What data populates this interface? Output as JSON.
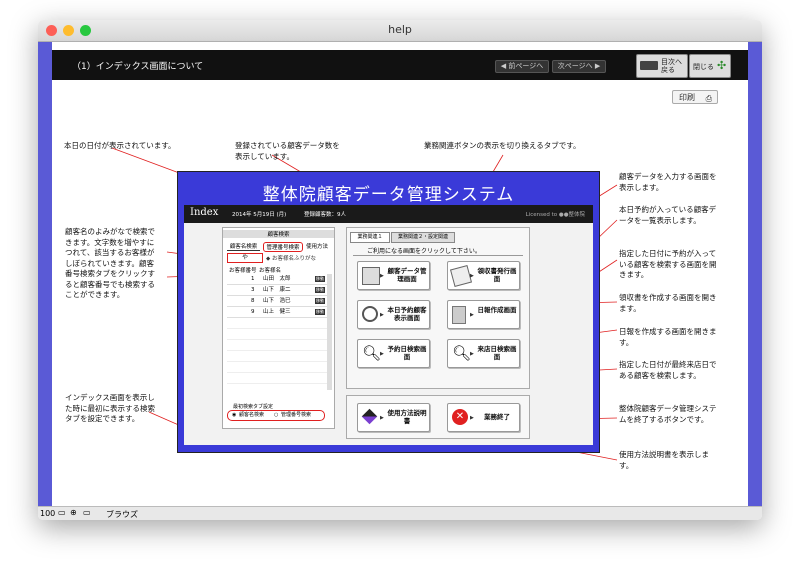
{
  "window": {
    "title": "help"
  },
  "header": {
    "title": "（1）インデックス画面について",
    "prev_label": "◀ 前ページへ",
    "next_label": "次ページへ ▶",
    "toc_label": "目次へ戻る",
    "close_label": "閉じる"
  },
  "print_label": "印刷",
  "annotations": {
    "date": "本日の日付が表示されています。",
    "count": "登録されている顧客データ数を表示しています。",
    "tab_switch": "業務関連ボタンの表示を切り換えるタブです。",
    "furigana": "顧客名のよみがなで検索できます。文字数を増やすにつれて、該当するお客様がしぼられていきます。顧客番号検索タブをクリックすると顧客番号でも検索することができます。",
    "default_tab": "インデックス画面を表示した時に最初に表示する検索タブを設定できます。",
    "customer_data": "顧客データを入力する画面を表示します。",
    "today_booking": "本日予約が入っている顧客データを一覧表示します。",
    "booking_search": "指定した日付に予約が入っている顧客を検索する画面を開きます。",
    "receipt": "領収書を作成する画面を開きます。",
    "daily_report": "日報を作成する画面を開きます。",
    "visit_search": "指定した日付が最終来店日である顧客を検索します。",
    "quit": "整体院顧客データ管理システムを終了するボタンです。",
    "manual": "使用方法説明書を表示します。"
  },
  "app": {
    "title": "整体院顧客データ管理システム",
    "index_label": "Index",
    "date": "2014年 5月19日 (月)",
    "count": "登録顧客数：9人",
    "license": "Licensed to ●●整体院",
    "search": {
      "panel_title": "顧客検索",
      "tabs": [
        "顧客名検索",
        "管理番号検索",
        "使用方法"
      ],
      "input_value": "や",
      "hint": "◆ お客様名ふりがな",
      "col_no": "お客様番号",
      "col_name": "お客様名",
      "rows": [
        {
          "no": "1",
          "name": "山田　太郎",
          "badge": "移動"
        },
        {
          "no": "3",
          "name": "山下　康二",
          "badge": "移動"
        },
        {
          "no": "8",
          "name": "山下　浩已",
          "badge": "移動"
        },
        {
          "no": "9",
          "name": "山上　健三",
          "badge": "移動"
        }
      ],
      "default_title": "最初検索タブ設定",
      "default_opt1": "顧客名検索",
      "default_opt2": "管理番号検索"
    },
    "biz_tabs": [
      "業務関連１",
      "業務関連２・設定関連"
    ],
    "instruction": "ご利用になる画面をクリックして下さい。",
    "buttons": {
      "customer_data": "顧客データ管理画面",
      "receipt": "領収書発行画面",
      "today_booking": "本日予約顧客表示画面",
      "daily_report": "日報作成画面",
      "booking_search": "予約日検索画面",
      "visit_search": "来店日検索画面",
      "manual": "使用方法説明書",
      "quit": "業務終了"
    }
  },
  "statusbar": {
    "zoom": "100",
    "mode": "ブラウズ"
  },
  "colors": {
    "frame": "#5a5ad6",
    "app_bg": "#3a3ad8",
    "header": "#111111",
    "accent_red": "#e02020"
  }
}
